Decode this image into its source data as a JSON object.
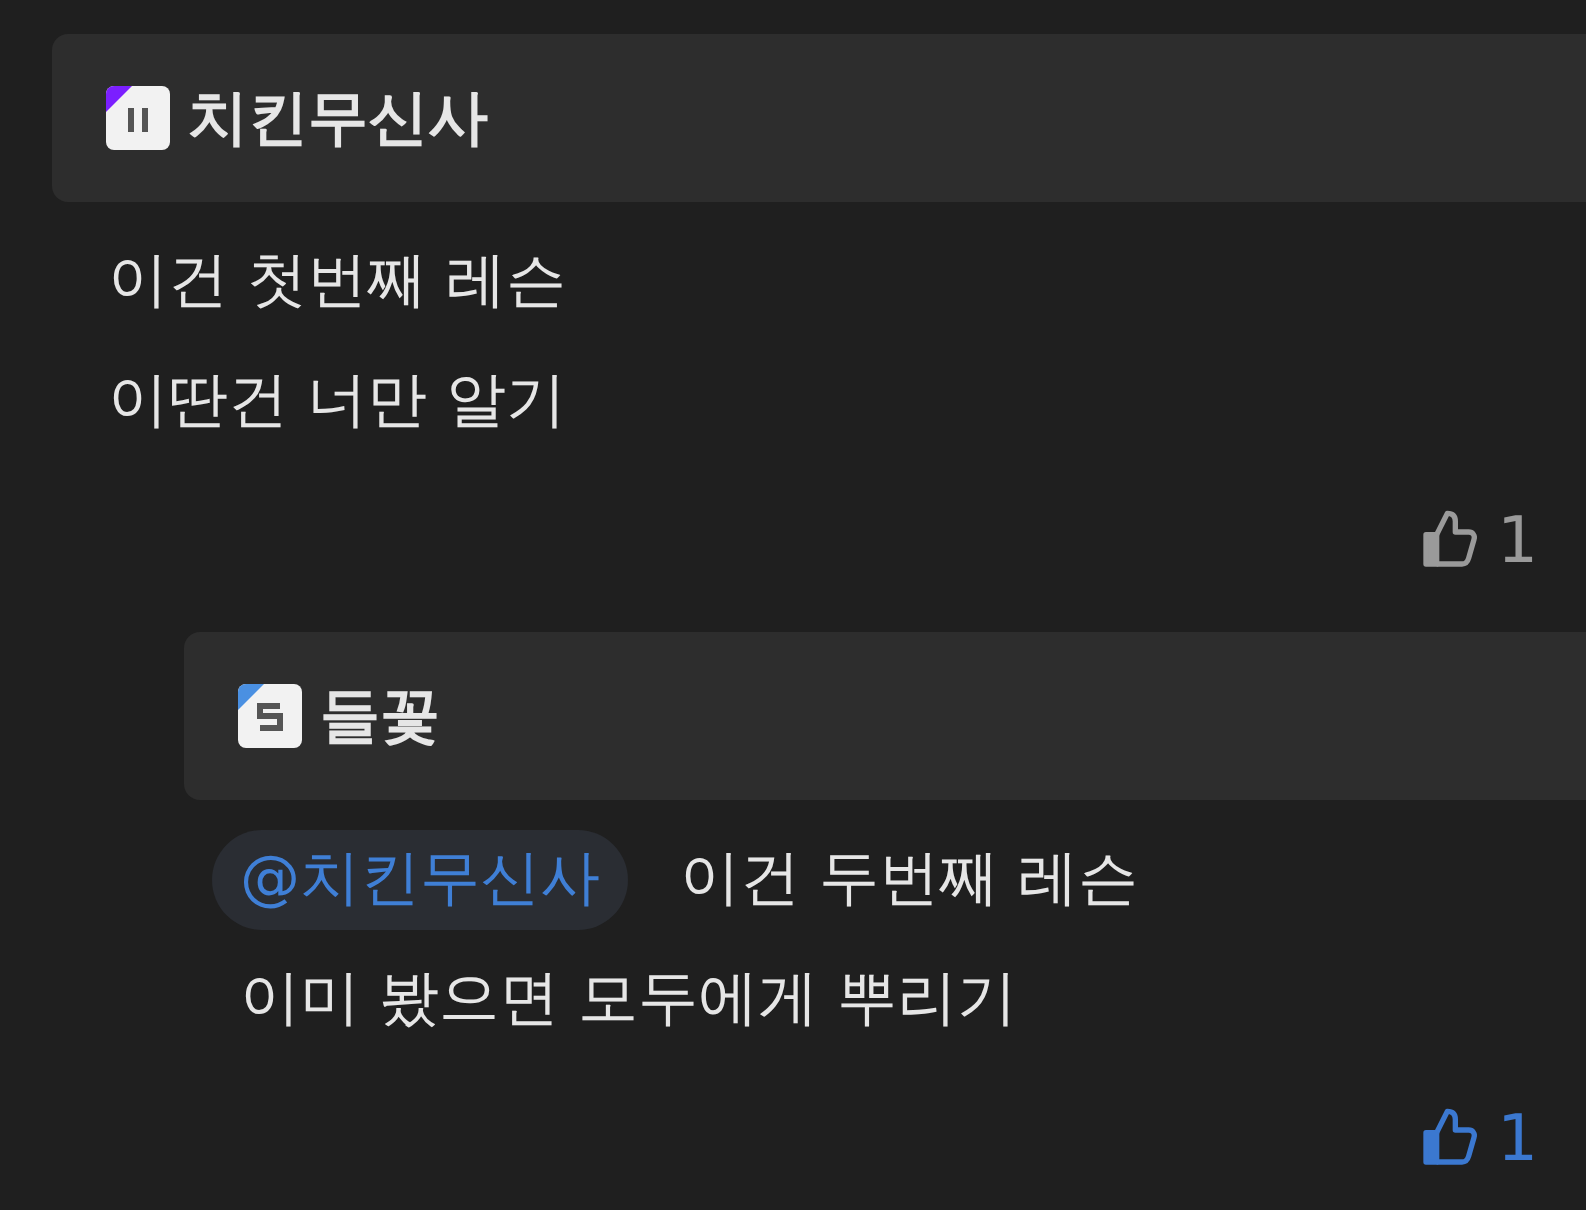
{
  "comments": [
    {
      "author": "치킨무신사",
      "badge": {
        "kind": "pause",
        "color": "#7b1fff"
      },
      "lines": [
        "이건 첫번째 레슨",
        "이딴건 너만 알기"
      ],
      "like": {
        "count": "1",
        "selected": false
      },
      "replies": [
        {
          "author": "들꽃",
          "badge": {
            "kind": "s",
            "color": "#4a90e2"
          },
          "mention": "@치킨무신사",
          "lines": [
            "이건 두번째 레슨",
            "이미 봤으면 모두에게 뿌리기"
          ],
          "like": {
            "count": "1",
            "selected": true
          }
        }
      ]
    }
  ]
}
